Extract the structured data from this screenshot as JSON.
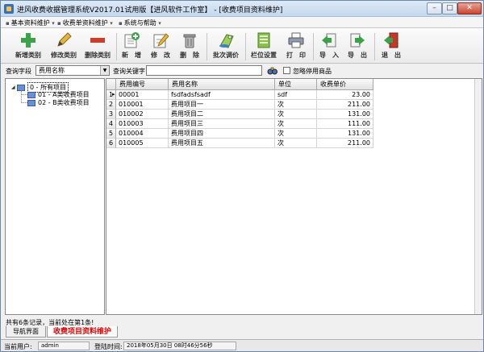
{
  "window": {
    "title": "进风收费收据管理系统V2017.01试用版【进风软件工作室】 - [收费项目资料维护]",
    "minimize": "–",
    "maximize": "□",
    "close": "✕"
  },
  "menu": {
    "items": [
      "基本资料维护",
      "收费单资料维护",
      "系统与帮助"
    ]
  },
  "toolbar": {
    "buttons": [
      {
        "label": "新增类别",
        "icon": "add-category-icon"
      },
      {
        "label": "修改类别",
        "icon": "edit-category-icon"
      },
      {
        "label": "删除类别",
        "icon": "delete-category-icon"
      },
      {
        "label": "新　增",
        "icon": "add-item-icon"
      },
      {
        "label": "修　改",
        "icon": "edit-item-icon"
      },
      {
        "label": "删　除",
        "icon": "delete-item-icon"
      },
      {
        "label": "批次调价",
        "icon": "batch-price-icon"
      },
      {
        "label": "栏位设置",
        "icon": "column-settings-icon"
      },
      {
        "label": "打　印",
        "icon": "printer-icon"
      },
      {
        "label": "导　入",
        "icon": "import-icon"
      },
      {
        "label": "导　出",
        "icon": "export-icon"
      },
      {
        "label": "退　出",
        "icon": "exit-icon"
      }
    ]
  },
  "search": {
    "field_label": "查询字段",
    "field_value": "费用名称",
    "keyword_label": "查询关键字",
    "keyword_value": "",
    "ignore_label": "忽略停用商品"
  },
  "tree": {
    "root": "0 - 所有项目",
    "children": [
      "01 - A类收费项目",
      "02 - B类收费项目"
    ]
  },
  "grid": {
    "columns": [
      "费用编号",
      "费用名称",
      "单位",
      "收费单价"
    ],
    "rows": [
      {
        "n": "1",
        "code": "00001",
        "name": "fsdfadsfsadf",
        "unit": "sdf",
        "price": "23.00",
        "current": true
      },
      {
        "n": "2",
        "code": "010001",
        "name": "费用项目一",
        "unit": "次",
        "price": "211.00"
      },
      {
        "n": "3",
        "code": "010002",
        "name": "费用项目二",
        "unit": "次",
        "price": "131.00"
      },
      {
        "n": "4",
        "code": "010003",
        "name": "费用项目三",
        "unit": "次",
        "price": "111.00"
      },
      {
        "n": "5",
        "code": "010004",
        "name": "费用项目四",
        "unit": "次",
        "price": "131.00"
      },
      {
        "n": "6",
        "code": "010005",
        "name": "费用项目五",
        "unit": "次",
        "price": "211.00"
      }
    ]
  },
  "status": {
    "records": "共有6条记录，当前处在第1条!",
    "tab_nav": "导航界面",
    "tab_active": "收费项目资料维护",
    "user_label": "当前用户:",
    "user_value": "admin",
    "login_label": "登陆时间:",
    "login_value": "2018年05月30日 08时46分56秒"
  },
  "colors": {
    "active_tab_text": "#e00000",
    "folder": "#6b8fd3"
  }
}
